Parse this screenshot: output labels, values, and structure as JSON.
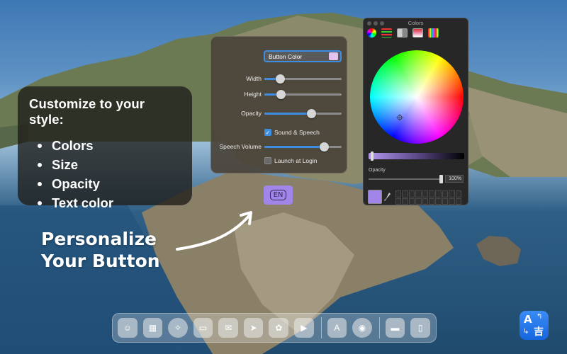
{
  "info_card": {
    "heading": "Customize to your style:",
    "items": [
      "Colors",
      "Size",
      "Opacity",
      "Text color"
    ]
  },
  "promo": {
    "line1": "Personalize",
    "line2": "Your Button"
  },
  "settings": {
    "button_color_label": "Button Color",
    "button_color_value": "#e3c3ee",
    "width_label": "Width",
    "width_level": 0.2,
    "height_label": "Height",
    "height_level": 0.21,
    "opacity_label": "Opacity",
    "opacity_level": 0.61,
    "sound_label": "Sound & Speech",
    "sound_checked": true,
    "volume_label": "Speech Volume",
    "volume_level": 0.77,
    "login_label": "Launch at Login",
    "login_checked": false
  },
  "en_button": {
    "label": "EN",
    "color": "#a185e8"
  },
  "colors_panel": {
    "title": "Colors",
    "opacity_label": "Opacity",
    "opacity_value": "100%",
    "current_color": "#a185e8",
    "tools": [
      "color-wheel",
      "color-sliders",
      "color-palettes",
      "image-palettes",
      "pencils"
    ]
  },
  "dock": {
    "apps": [
      "finder-icon",
      "launchpad-icon",
      "safari-icon",
      "messages-icon",
      "mail-icon",
      "maps-icon",
      "photos-icon",
      "facetime-icon",
      "app-store-icon",
      "podcasts-icon",
      "folder-icon",
      "trash-icon"
    ]
  },
  "translator_icon": {
    "latin": "A",
    "cjk": "吉"
  },
  "colors": {
    "accent": "#3d8ee0",
    "panel_bg": "#4a443a"
  }
}
